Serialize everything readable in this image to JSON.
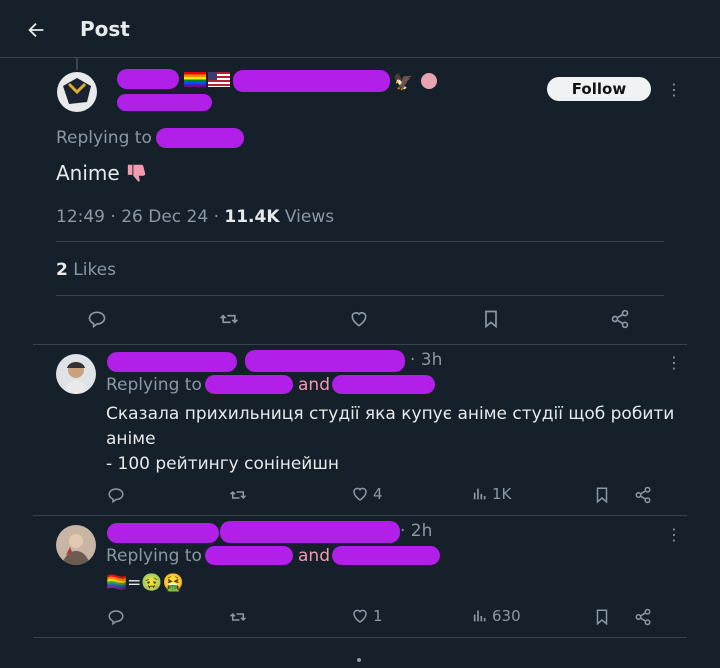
{
  "header": {
    "title": "Post"
  },
  "main_post": {
    "follow_label": "Follow",
    "replying_to": "Replying to",
    "text": "Anime",
    "time": "12:49 · 26 Dec 24 · ",
    "views_count": "11.4K",
    "views_label": " Views",
    "likes_count": "2",
    "likes_label": " Likes"
  },
  "replies": [
    {
      "time": "· 3h",
      "replying_to": "Replying to",
      "and": "and",
      "text_line1": "Сказала прихильниця студії яка купує аніме студії щоб робити",
      "text_line2": "аніме",
      "text_line3": "- 100 рейтингу сонінейшн",
      "likes": "4",
      "views": "1K"
    },
    {
      "time": "· 2h",
      "replying_to": "Replying to",
      "and": "and",
      "text": "🏳️‍🌈=🤢🤮",
      "likes": "1",
      "views": "630"
    }
  ],
  "colors": {
    "background": "#15202b",
    "redaction": "#b11fe8",
    "muted": "#8b98a5",
    "divider": "#38444d"
  }
}
